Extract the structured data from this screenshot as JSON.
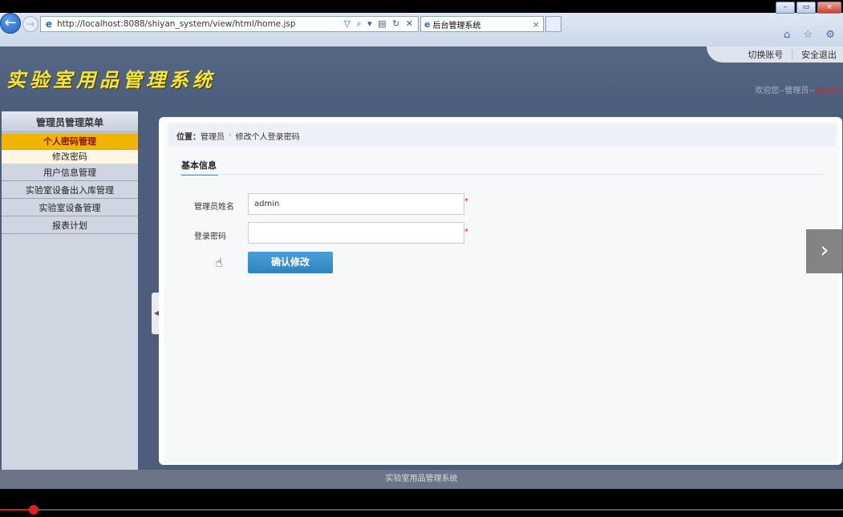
{
  "browser": {
    "url": "http://localhost:8088/shiyan_system/view/html/home.jsp",
    "tab_title": "后台管理系统",
    "tab_close": "×",
    "window_buttons": [
      "–",
      "▭",
      "×"
    ],
    "address_tools": "▽ ⌕ ▾ ▤ ↻ ✕",
    "right_icons": "⌂ ☆ ⚙"
  },
  "header": {
    "logo": "实验室用品管理系统",
    "links": [
      "切换账号",
      "安全退出"
    ],
    "welcome_prefix": "欢迎您--管理员--",
    "welcome_user": "admin"
  },
  "sidebar": {
    "title": "管理员管理菜单",
    "items": [
      {
        "label": "个人密码管理"
      },
      {
        "label": "修改密码"
      },
      {
        "label": "用户信息管理"
      },
      {
        "label": "实验室设备出入库管理"
      },
      {
        "label": "实验室设备管理"
      },
      {
        "label": "报表计划"
      }
    ]
  },
  "breadcrumb": {
    "prefix": "位置：",
    "items": [
      "管理员",
      "修改个人登录密码"
    ],
    "separator": "›"
  },
  "form": {
    "section_title": "基本信息",
    "fields": [
      {
        "label": "管理员姓名",
        "value": "admin",
        "required": "*"
      },
      {
        "label": "登录密码",
        "value": "",
        "required": "*"
      }
    ],
    "submit_label": "确认修改"
  },
  "footer": {
    "text": "实验室用品管理系统"
  },
  "colors": {
    "accent": "#f0b500",
    "button": "#3a8fc7",
    "header_bg": "#4d5e7c"
  }
}
